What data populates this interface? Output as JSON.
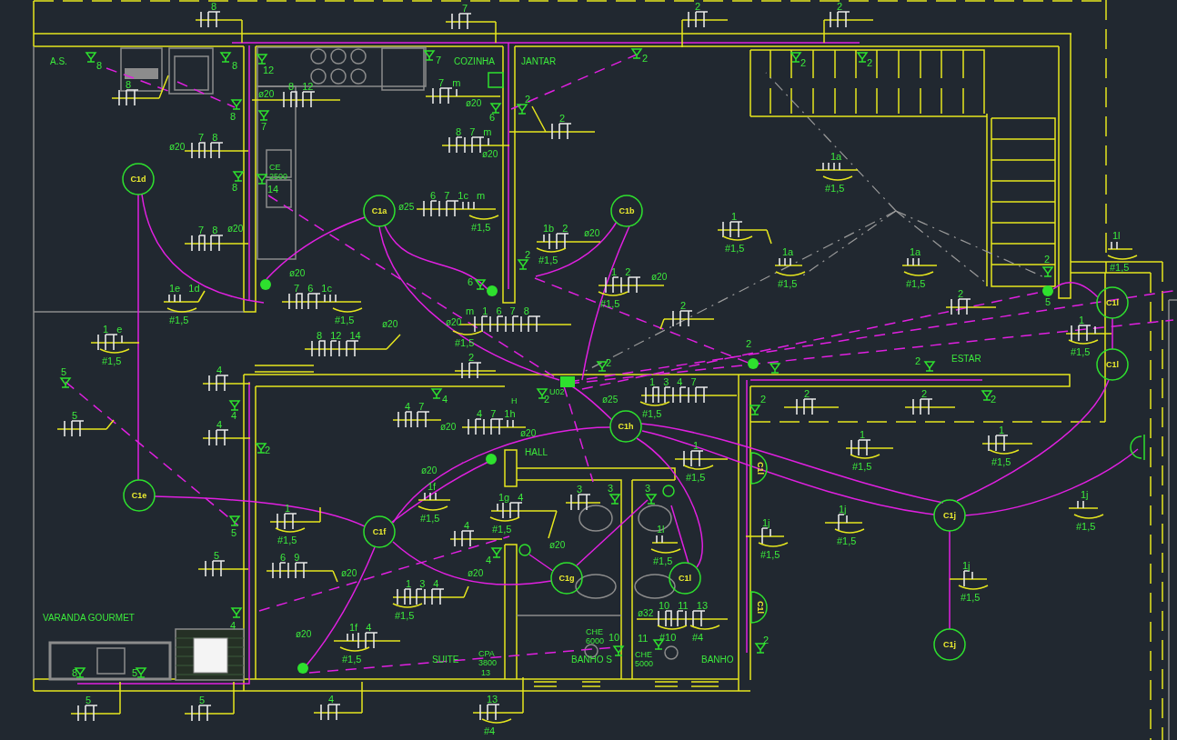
{
  "plan": {
    "room_labels": [
      "A.S.",
      "COZINHA",
      "JANTAR",
      "ESTAR",
      "HALL",
      "VARANDA GOURMET",
      "SUITE",
      "BANHO S",
      "BANHO"
    ],
    "light_points": [
      "C1d",
      "C1a",
      "C1b",
      "C1l",
      "C1l",
      "C1h",
      "C1e",
      "C1j",
      "C1f",
      "C1g",
      "C1l",
      "C1j"
    ],
    "wall_lights": [
      "C1l",
      "C1l"
    ],
    "outlets": [
      "8",
      "8",
      "12",
      "7",
      "2",
      "2",
      "2",
      "2",
      "8",
      "6",
      "7",
      "8",
      "14",
      "2",
      "2",
      "6",
      "5",
      "2",
      "2",
      "2",
      "5",
      "4",
      "2",
      "2",
      "2",
      "4",
      "2",
      "3",
      "3",
      "5",
      "4",
      "4",
      "10",
      "11",
      "2",
      "8",
      "5"
    ],
    "runs": [
      {
        "circuits": "8"
      },
      {
        "circuits": "7"
      },
      {
        "circuits": "2"
      },
      {
        "circuits": "2"
      },
      {
        "circuits": "8"
      },
      {
        "circuits": "8 12",
        "conduit": "ø20"
      },
      {
        "circuits": "7 m",
        "conduit": "ø20"
      },
      {
        "circuits": "7 8",
        "conduit": "ø20"
      },
      {
        "circuits": "8 7 m",
        "conduit": "ø20"
      },
      {
        "circuits": "2"
      },
      {
        "circuits": "7 8",
        "conduit": "ø20"
      },
      {
        "circuits": "6 7 1c m",
        "gauges": [
          "#1,5"
        ],
        "conduit": "ø25"
      },
      {
        "circuits": "1a",
        "gauges": [
          "#1,5"
        ]
      },
      {
        "circuits": "1b 2",
        "gauges": [
          "#1,5"
        ],
        "conduit": "ø20"
      },
      {
        "circuits": "1",
        "gauges": [
          "#1,5"
        ]
      },
      {
        "circuits": "1 e",
        "gauges": [
          "#1,5"
        ]
      },
      {
        "circuits": "1e 1d",
        "gauges": [
          "#1,5"
        ]
      },
      {
        "circuits": "7 6 1c",
        "gauges": [
          "#1,5"
        ],
        "conduit": "ø20"
      },
      {
        "circuits": "8 12 14",
        "conduit": "ø20"
      },
      {
        "circuits": "m 1 6 7 8",
        "gauges": [
          "#1,5"
        ],
        "conduit": "ø20"
      },
      {
        "circuits": "1 2",
        "gauges": [
          "#1,5"
        ],
        "conduit": "ø20"
      },
      {
        "circuits": "1a",
        "gauges": [
          "#1,5"
        ]
      },
      {
        "circuits": "1a",
        "gauges": [
          "#1,5"
        ]
      },
      {
        "circuits": "1l",
        "gauges": [
          "#1,5"
        ]
      },
      {
        "circuits": "2"
      },
      {
        "circuits": "2"
      },
      {
        "circuits": "4"
      },
      {
        "circuits": "2"
      },
      {
        "circuits": "1",
        "gauges": [
          "#1,5"
        ]
      },
      {
        "circuits": "5"
      },
      {
        "circuits": "4"
      },
      {
        "circuits": "4 7",
        "conduit": "ø20"
      },
      {
        "circuits": "4 7 1h",
        "conduit": "ø20"
      },
      {
        "circuits": "1 3 4 7",
        "gauges": [
          "#1,5"
        ],
        "conduit": "ø25"
      },
      {
        "circuits": "2"
      },
      {
        "circuits": "2"
      },
      {
        "circuits": "1",
        "gauges": [
          "#1,5"
        ]
      },
      {
        "circuits": "1f",
        "gauges": [
          "#1,5"
        ],
        "conduit": "ø20"
      },
      {
        "circuits": "1",
        "gauges": [
          "#1,5"
        ]
      },
      {
        "circuits": "1",
        "gauges": [
          "#1,5"
        ]
      },
      {
        "circuits": "1",
        "gauges": [
          "#1,5"
        ]
      },
      {
        "circuits": "4"
      },
      {
        "circuits": "1g 4",
        "gauges": [
          "#1,5"
        ],
        "conduit": "ø20"
      },
      {
        "circuits": "3"
      },
      {
        "circuits": "1l",
        "gauges": [
          "#1,5"
        ]
      },
      {
        "circuits": "1j",
        "gauges": [
          "#1,5"
        ]
      },
      {
        "circuits": "1j",
        "gauges": [
          "#1,5"
        ]
      },
      {
        "circuits": "1j",
        "gauges": [
          "#1,5"
        ]
      },
      {
        "circuits": "5"
      },
      {
        "circuits": "6 9",
        "conduit": "ø20"
      },
      {
        "circuits": "1 3 4",
        "gauges": [
          "#1,5"
        ],
        "conduit": "ø20"
      },
      {
        "circuits": "1f 4",
        "gauges": [
          "#1,5"
        ],
        "conduit": "ø20"
      },
      {
        "circuits": "10 11 13",
        "gauges": [
          "#10",
          "#4"
        ],
        "conduit": "ø32"
      },
      {
        "circuits": "1j",
        "gauges": [
          "#1,5"
        ]
      },
      {
        "circuits": "5"
      },
      {
        "circuits": "5"
      },
      {
        "circuits": "4"
      },
      {
        "circuits": "13",
        "gauges": [
          "#4"
        ]
      }
    ],
    "notes": [
      "CE",
      "2500",
      "U02",
      "H",
      "CHE",
      "6000",
      "CHE",
      "5000",
      "CPA",
      "3800",
      "13"
    ]
  }
}
